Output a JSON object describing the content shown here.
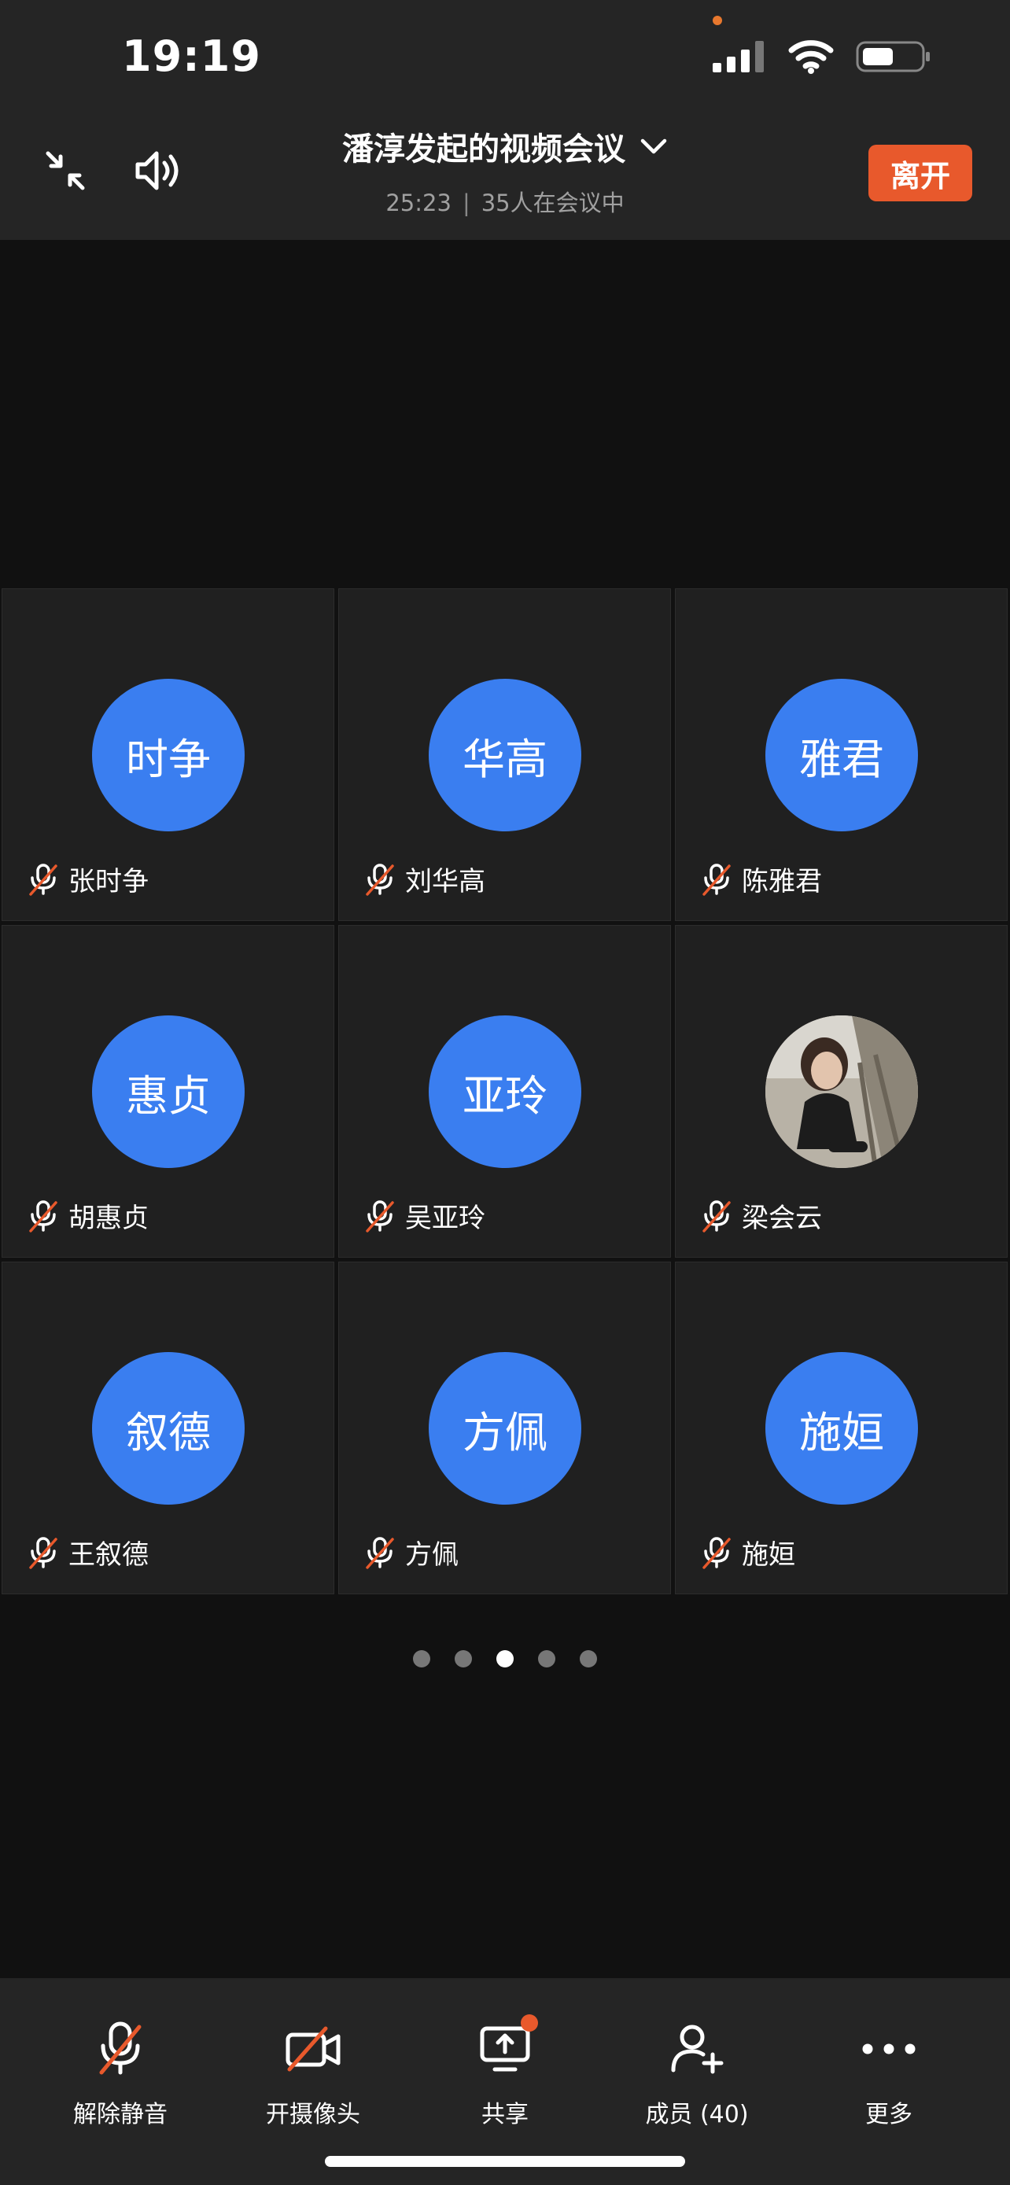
{
  "status_bar": {
    "time": "19:19"
  },
  "header": {
    "title": "潘淳发起的视频会议",
    "duration": "25:23",
    "separator": "|",
    "participants_text": "35人在会议中",
    "leave_label": "离开"
  },
  "participants": [
    {
      "avatar_text": "时争",
      "name": "张时争"
    },
    {
      "avatar_text": "华高",
      "name": "刘华高"
    },
    {
      "avatar_text": "雅君",
      "name": "陈雅君"
    },
    {
      "avatar_text": "惠贞",
      "name": "胡惠贞"
    },
    {
      "avatar_text": "亚玲",
      "name": "吴亚玲"
    },
    {
      "avatar_text": "",
      "name": "梁会云",
      "avatar_photo": true
    },
    {
      "avatar_text": "叙德",
      "name": "王叙德"
    },
    {
      "avatar_text": "方佩",
      "name": "方佩"
    },
    {
      "avatar_text": "施姮",
      "name": "施姮"
    }
  ],
  "pagination": {
    "total": 5,
    "current": 3
  },
  "toolbar": {
    "unmute_label": "解除静音",
    "camera_label": "开摄像头",
    "share_label": "共享",
    "members_label": "成员 (40)",
    "more_label": "更多"
  },
  "colors": {
    "avatar_blue": "#3A7EF0",
    "accent_orange": "#E8592C",
    "mute_red": "#E8592C"
  }
}
